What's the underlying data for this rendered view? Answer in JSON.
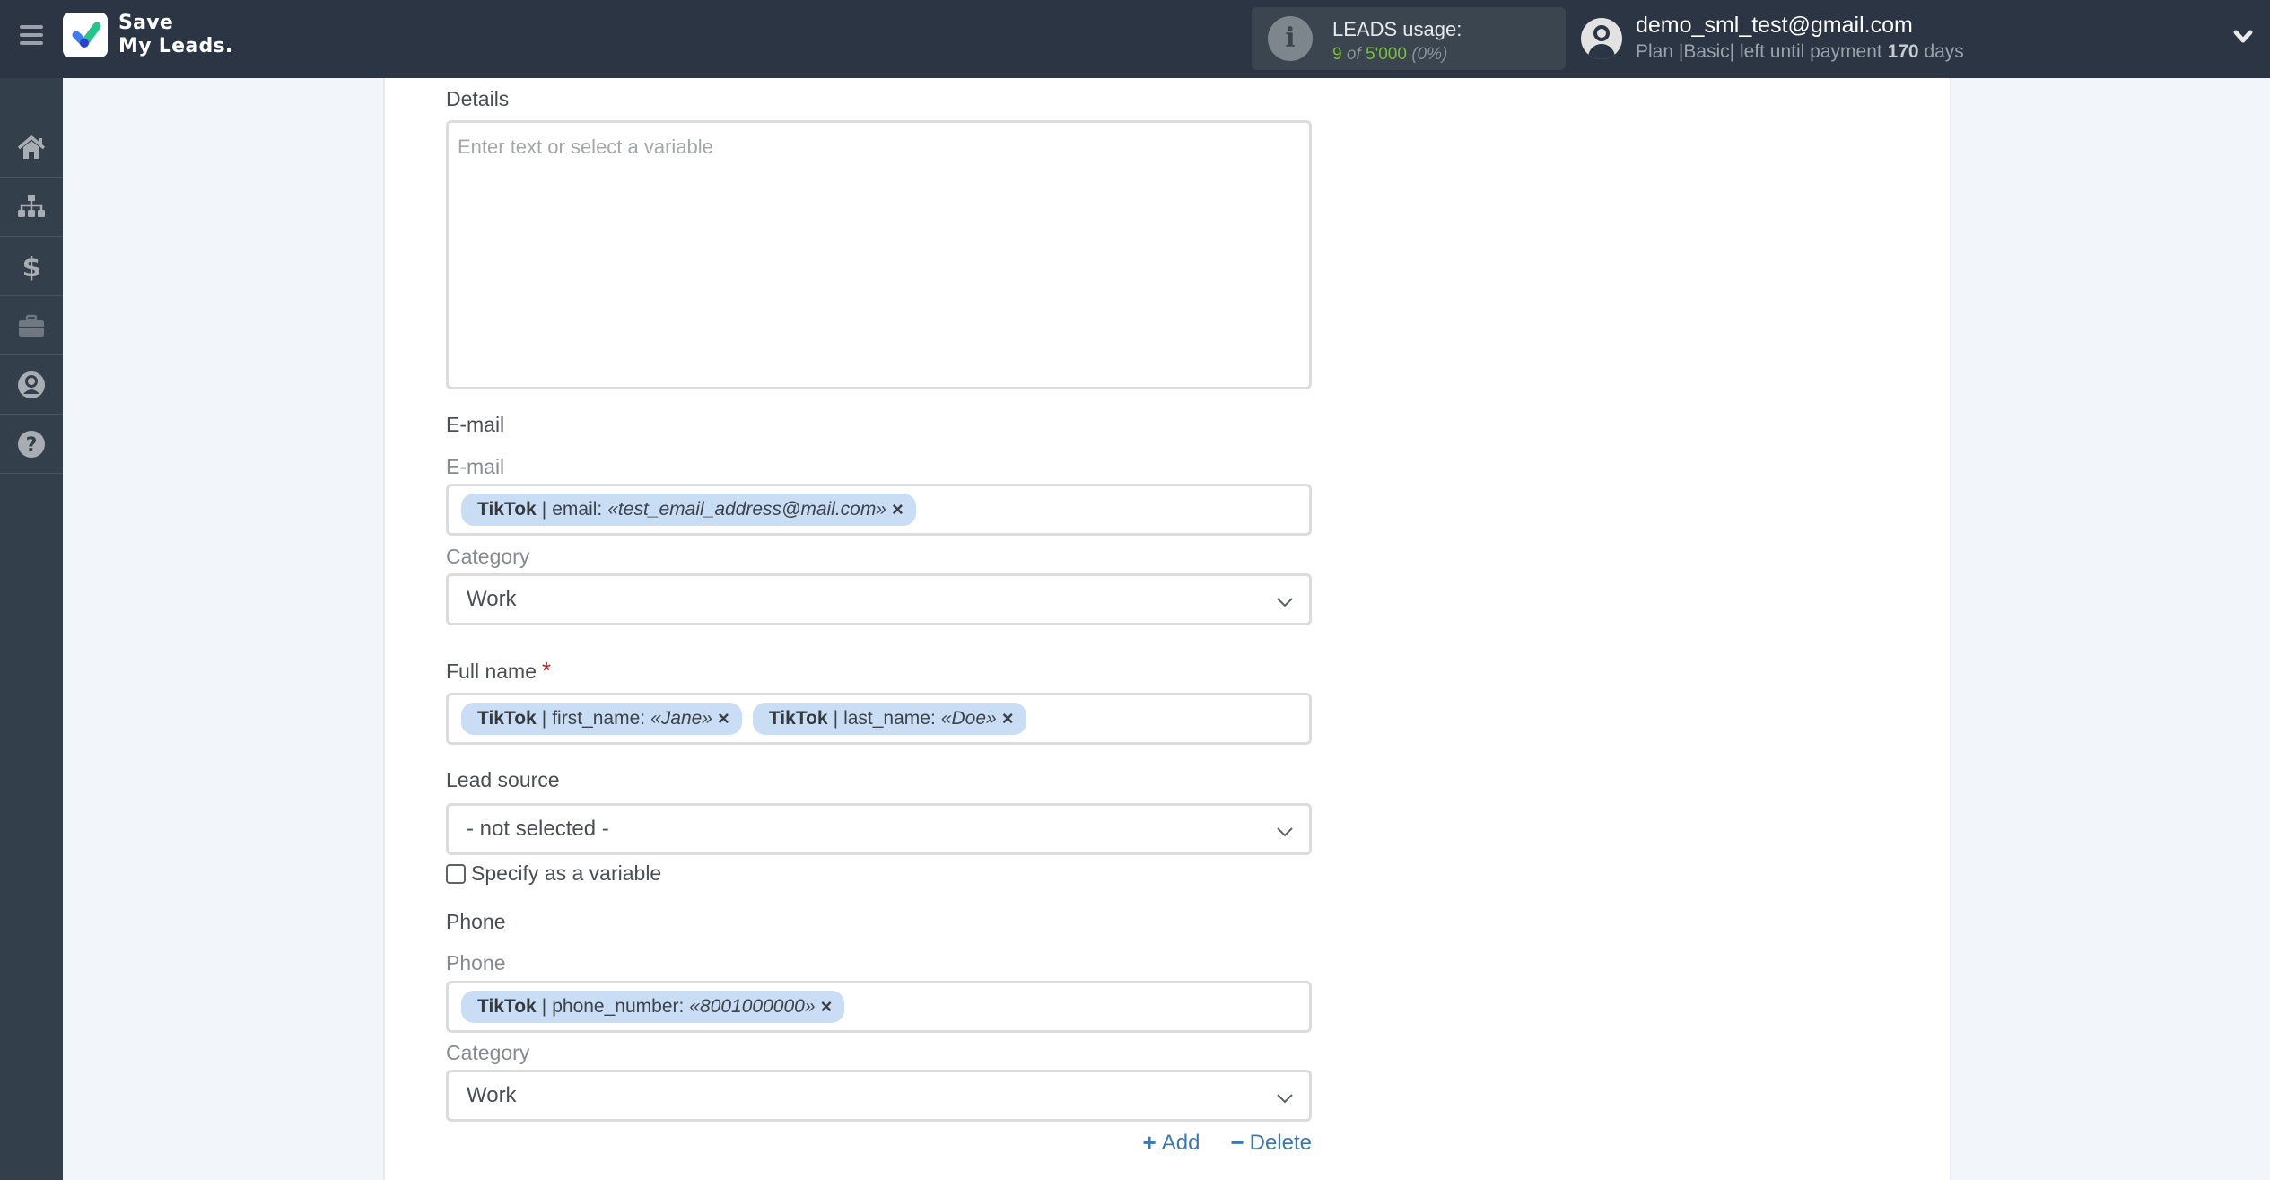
{
  "header": {
    "logo_line1": "Save",
    "logo_line2": "My Leads.",
    "usage": {
      "title": "LEADS usage:",
      "used": "9",
      "of": "of",
      "limit": "5'000",
      "percent": "(0%)"
    },
    "user": {
      "email": "demo_sml_test@gmail.com",
      "plan_prefix": "Plan |Basic| left until payment",
      "days": "170",
      "days_suffix": "days"
    }
  },
  "sidebar": {
    "items": [
      {
        "name": "home",
        "icon": "home-icon"
      },
      {
        "name": "connections",
        "icon": "sitemap-icon"
      },
      {
        "name": "billing",
        "icon": "dollar-icon"
      },
      {
        "name": "tools",
        "icon": "briefcase-icon"
      },
      {
        "name": "account",
        "icon": "user-circle-icon"
      },
      {
        "name": "help",
        "icon": "question-circle-icon"
      }
    ]
  },
  "form": {
    "details": {
      "label": "Details",
      "placeholder": "Enter text or select a variable",
      "value": ""
    },
    "email": {
      "heading": "E-mail",
      "sub_label": "E-mail",
      "tags": [
        {
          "source": "TikTok",
          "field": "email:",
          "value": "«test_email_address@mail.com»"
        }
      ],
      "category_label": "Category",
      "category_value": "Work"
    },
    "full_name": {
      "label": "Full name",
      "required_mark": "*",
      "tags": [
        {
          "source": "TikTok",
          "field": "first_name:",
          "value": "«Jane»"
        },
        {
          "source": "TikTok",
          "field": "last_name:",
          "value": "«Doe»"
        }
      ]
    },
    "lead_source": {
      "label": "Lead source",
      "value": "- not selected -",
      "checkbox_label": "Specify as a variable",
      "checkbox_checked": false
    },
    "phone": {
      "heading": "Phone",
      "sub_label": "Phone",
      "tags": [
        {
          "source": "TikTok",
          "field": "phone_number:",
          "value": "«8001000000»"
        }
      ],
      "category_label": "Category",
      "category_value": "Work"
    },
    "actions": {
      "add_symbol": "+",
      "add_label": "Add",
      "delete_symbol": "−",
      "delete_label": "Delete"
    },
    "tag_separator": "|",
    "tag_remove": "×"
  },
  "colors": {
    "header_bg": "#2b3543",
    "sidebar_bg": "#343f4c",
    "tag_bg": "#c9ddf4",
    "link": "#3b78b5",
    "usage_green": "#7cbf3c",
    "required": "#c0161f"
  }
}
